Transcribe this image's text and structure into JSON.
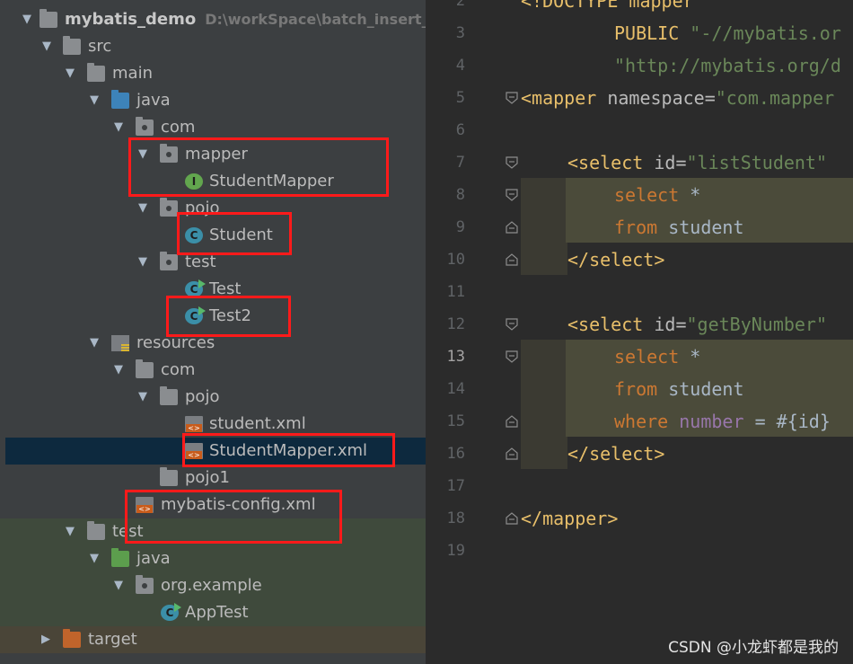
{
  "tree": {
    "root": {
      "name": "mybatis_demo",
      "path": "D:\\workSpace\\batch_insert_my"
    },
    "items": [
      {
        "label": "src"
      },
      {
        "label": "main"
      },
      {
        "label": "java"
      },
      {
        "label": "com"
      },
      {
        "label": "mapper"
      },
      {
        "label": "StudentMapper",
        "badge": "I"
      },
      {
        "label": "pojo"
      },
      {
        "label": "Student",
        "badge": "C"
      },
      {
        "label": "test"
      },
      {
        "label": "Test",
        "badge": "C"
      },
      {
        "label": "Test2",
        "badge": "C"
      },
      {
        "label": "resources"
      },
      {
        "label": "com"
      },
      {
        "label": "pojo"
      },
      {
        "label": "student.xml",
        "badge": "<>"
      },
      {
        "label": "StudentMapper.xml",
        "badge": "<>"
      },
      {
        "label": "pojo1"
      },
      {
        "label": "mybatis-config.xml",
        "badge": "<>"
      },
      {
        "label": "test"
      },
      {
        "label": "java"
      },
      {
        "label": "org.example"
      },
      {
        "label": "AppTest",
        "badge": "C"
      },
      {
        "label": "target"
      }
    ]
  },
  "editor": {
    "line_numbers": [
      "2",
      "3",
      "4",
      "5",
      "6",
      "7",
      "8",
      "9",
      "10",
      "11",
      "12",
      "13",
      "14",
      "15",
      "16",
      "17",
      "18",
      "19"
    ],
    "active_line": "13",
    "code": {
      "l2": {
        "a": "<!DOCTYPE mapper"
      },
      "l3": {
        "a": "PUBLIC",
        "b": "\"-//mybatis.or"
      },
      "l4": {
        "a": "\"http://mybatis.org/d"
      },
      "l5": {
        "a": "<mapper",
        "b": "namespace",
        "c": "=",
        "d": "\"com.mapper"
      },
      "l7": {
        "a": "<select",
        "b": "id",
        "c": "=",
        "d": "\"listStudent\""
      },
      "l8": {
        "a": "select",
        "b": "*"
      },
      "l9": {
        "a": "from",
        "b": "student"
      },
      "l10": {
        "a": "</select>"
      },
      "l12": {
        "a": "<select",
        "b": "id",
        "c": "=",
        "d": "\"getByNumber\""
      },
      "l13": {
        "a": "select",
        "b": "*"
      },
      "l14": {
        "a": "from",
        "b": "student"
      },
      "l15": {
        "a": "where",
        "b": "number",
        "c": "=",
        "d": "#{id}"
      },
      "l16": {
        "a": "</select>"
      },
      "l18": {
        "a": "</mapper>"
      }
    }
  },
  "watermark": "CSDN @小龙虾都是我的"
}
